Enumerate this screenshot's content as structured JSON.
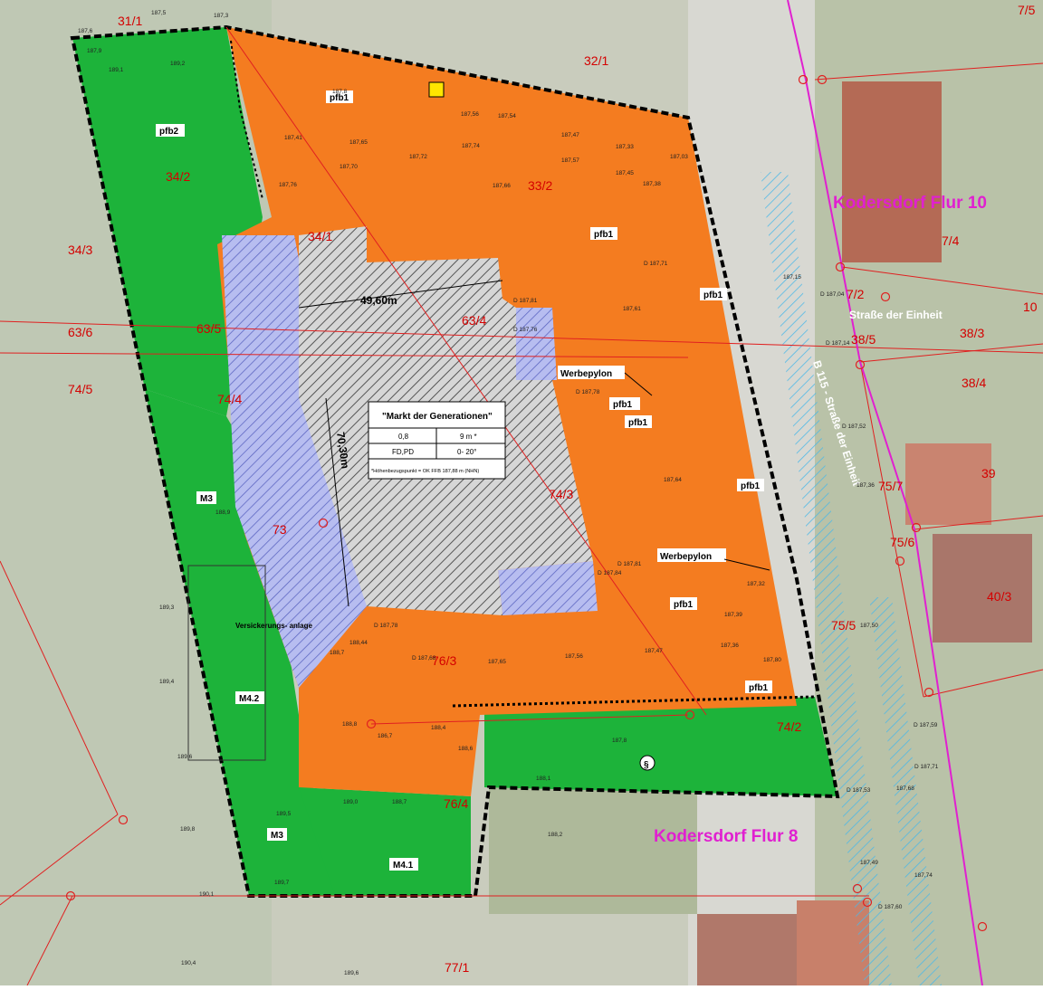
{
  "map": {
    "flur_labels": [
      "Kodersdorf Flur 10",
      "Kodersdorf Flur 8"
    ],
    "street_labels": [
      "Straße der Einheit",
      "B 115 - Straße der Einheit"
    ],
    "parcels": [
      "31/1",
      "32/1",
      "34/2",
      "33/2",
      "34/3",
      "34/1",
      "63/6",
      "63/5",
      "63/4",
      "74/5",
      "74/4",
      "74/3",
      "73",
      "76/3",
      "76/4",
      "74/2",
      "75/5",
      "75/6",
      "75/7",
      "7/5",
      "7/4",
      "7/2",
      "38/5",
      "38/3",
      "38/4",
      "39",
      "40/3",
      "10",
      "77/1"
    ],
    "zone_labels": [
      "pfb2",
      "pfb1",
      "pfb1",
      "pfb1",
      "pfb1",
      "pfb1",
      "pfb1",
      "pfb1",
      "pfb1",
      "M3",
      "M3",
      "M4.2",
      "M4.1"
    ],
    "markers": {
      "werbepylon_1": "Werbepylon",
      "werbepylon_2": "Werbepylon",
      "versickerung": "Versickerungs-\nanlage",
      "paragraph": "§"
    },
    "dimensions": {
      "width_label": "49,60m",
      "depth_label": "70,30m"
    },
    "legend_box": {
      "title": "\"Markt der Generationen\"",
      "row1_left": "0,8",
      "row1_right": "9 m *",
      "row2_left": "FD,PD",
      "row2_right": "0- 20°",
      "footnote": "*Höhenbezugspunkt = OK FFB 187,88 m (NHN)"
    },
    "elevations": [
      "187,6",
      "187,5",
      "187,3",
      "187,8",
      "189,1",
      "189,2",
      "187,9",
      "187,41",
      "187,65",
      "187,72",
      "187,56",
      "187,54",
      "187,47",
      "187,33",
      "187,03",
      "187,74",
      "187,70",
      "187,57",
      "187,45",
      "187,38",
      "187,76",
      "187,66",
      "D 187,71",
      "D 187,81",
      "D 187,76",
      "187,61",
      "D 187,78",
      "187,64",
      "D 187,84",
      "D 187,81",
      "187,32",
      "187,39",
      "D 187,78",
      "187,36",
      "187,47",
      "187,56",
      "187,65",
      "D 187,68",
      "187,80",
      "188,44",
      "188,7",
      "188,8",
      "188,4",
      "186,7",
      "188,6",
      "187,8",
      "188,1",
      "188,2",
      "189,0",
      "188,7",
      "189,5",
      "188,9",
      "189,3",
      "189,4",
      "189,6",
      "189,8",
      "190,1",
      "190,4",
      "189,7",
      "189,6",
      "187,15",
      "D 187,04",
      "D 187,14",
      "D 187,52",
      "187,36",
      "187,50",
      "D 187,59",
      "D 187,71",
      "187,68",
      "187,74",
      "187,49",
      "D 187,53",
      "D 187,60"
    ],
    "colors": {
      "orange": "#f47c20",
      "green": "#1db33a",
      "blue": "#9aa4e0",
      "hatch": "#888888",
      "parcel_line": "#e02020",
      "flur_line": "#e020d0"
    }
  }
}
